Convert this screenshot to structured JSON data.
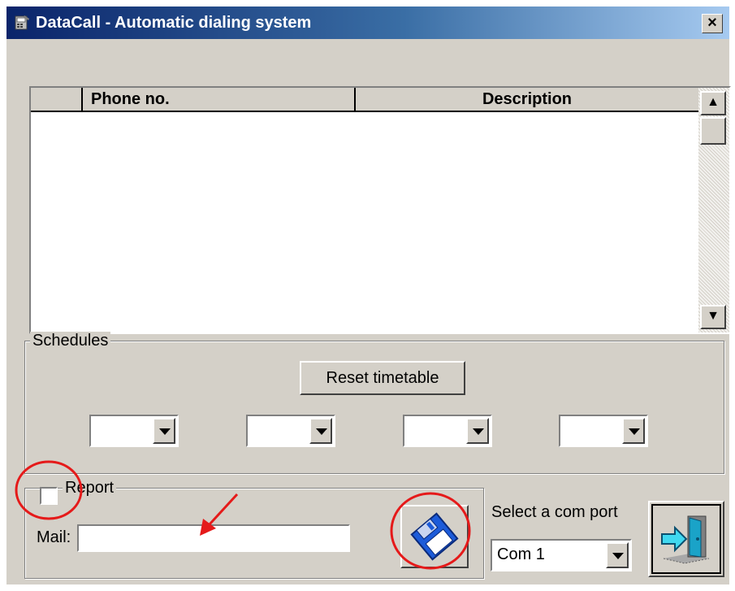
{
  "window": {
    "title": "DataCall - Automatic dialing system",
    "close_glyph": "×"
  },
  "table": {
    "columns": [
      "",
      "Phone no.",
      "Description"
    ],
    "rows": []
  },
  "schedules": {
    "legend": "Schedules",
    "reset_label": "Reset timetable",
    "slots": [
      "",
      "",
      "",
      ""
    ]
  },
  "report": {
    "label": "Report",
    "checked": false,
    "mail_label": "Mail:",
    "mail_value": ""
  },
  "com_port": {
    "label": "Select a com port",
    "selected": "Com 1"
  },
  "icons": {
    "save": "floppy-disk-icon",
    "exit": "exit-door-icon",
    "app": "phone-app-icon"
  },
  "colors": {
    "face": "#d4d0c8",
    "title_start": "#0a246a",
    "title_end": "#a6caf0",
    "annotation": "#e51a1a",
    "save_icon": "#1c5bd9",
    "exit_icon": "#1aa3c8"
  }
}
